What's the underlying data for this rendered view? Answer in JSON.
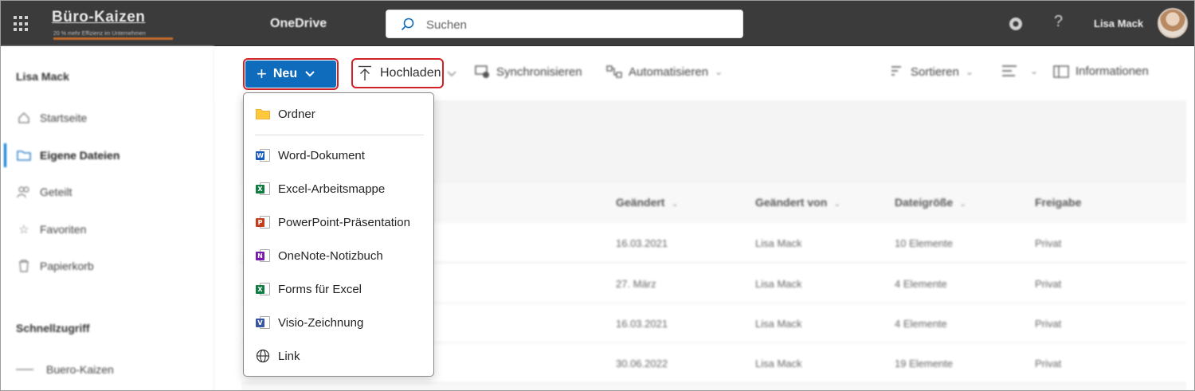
{
  "topbar": {
    "brand_name": "Büro-Kaizen",
    "brand_tagline": "20 % mehr Effizienz im Unternehmen",
    "app_name": "OneDrive",
    "search_placeholder": "Suchen",
    "help_glyph": "?",
    "user_name": "Lisa Mack"
  },
  "nav": {
    "user": "Lisa Mack",
    "items": [
      {
        "label": "Startseite",
        "icon": "home-icon"
      },
      {
        "label": "Eigene Dateien",
        "icon": "folder-icon",
        "active": true
      },
      {
        "label": "Geteilt",
        "icon": "people-icon"
      },
      {
        "label": "Favoriten",
        "icon": "star-icon"
      },
      {
        "label": "Papierkorb",
        "icon": "trash-icon"
      }
    ],
    "quick_access_title": "Schnellzugriff",
    "quick_items": [
      {
        "label": "Buero-Kaizen"
      }
    ]
  },
  "commands": {
    "new": "Neu",
    "upload": "Hochladen",
    "sync": "Synchronisieren",
    "automate": "Automatisieren",
    "sort": "Sortieren",
    "info": "Informationen"
  },
  "table": {
    "columns": [
      "Geändert",
      "Geändert von",
      "Dateigröße",
      "Freigabe"
    ],
    "rows": [
      {
        "modified": "16.03.2021",
        "modified_by": "Lisa Mack",
        "size": "10 Elemente",
        "sharing": "Privat"
      },
      {
        "modified": "27. März",
        "modified_by": "Lisa Mack",
        "size": "4 Elemente",
        "sharing": "Privat"
      },
      {
        "modified": "16.03.2021",
        "modified_by": "Lisa Mack",
        "size": "4 Elemente",
        "sharing": "Privat"
      },
      {
        "modified": "30.06.2022",
        "modified_by": "Lisa Mack",
        "size": "19 Elemente",
        "sharing": "Privat"
      }
    ]
  },
  "new_menu": {
    "items": [
      {
        "label": "Ordner",
        "icon": "folder-icon"
      },
      {
        "label": "Word-Dokument",
        "icon": "word-icon",
        "letter": "W",
        "color": "#185abd"
      },
      {
        "label": "Excel-Arbeitsmappe",
        "icon": "excel-icon",
        "letter": "X",
        "color": "#107c41"
      },
      {
        "label": "PowerPoint-Präsentation",
        "icon": "powerpoint-icon",
        "letter": "P",
        "color": "#c43e1c"
      },
      {
        "label": "OneNote-Notizbuch",
        "icon": "onenote-icon",
        "letter": "N",
        "color": "#7719aa"
      },
      {
        "label": "Forms für Excel",
        "icon": "forms-excel-icon",
        "letter": "X",
        "color": "#107c41"
      },
      {
        "label": "Visio-Zeichnung",
        "icon": "visio-icon",
        "letter": "V",
        "color": "#3955a3"
      },
      {
        "label": "Link",
        "icon": "globe-icon"
      }
    ]
  },
  "colors": {
    "accent": "#0f6cbd",
    "highlight": "#d1222a",
    "topbar": "#3b3b3b"
  }
}
